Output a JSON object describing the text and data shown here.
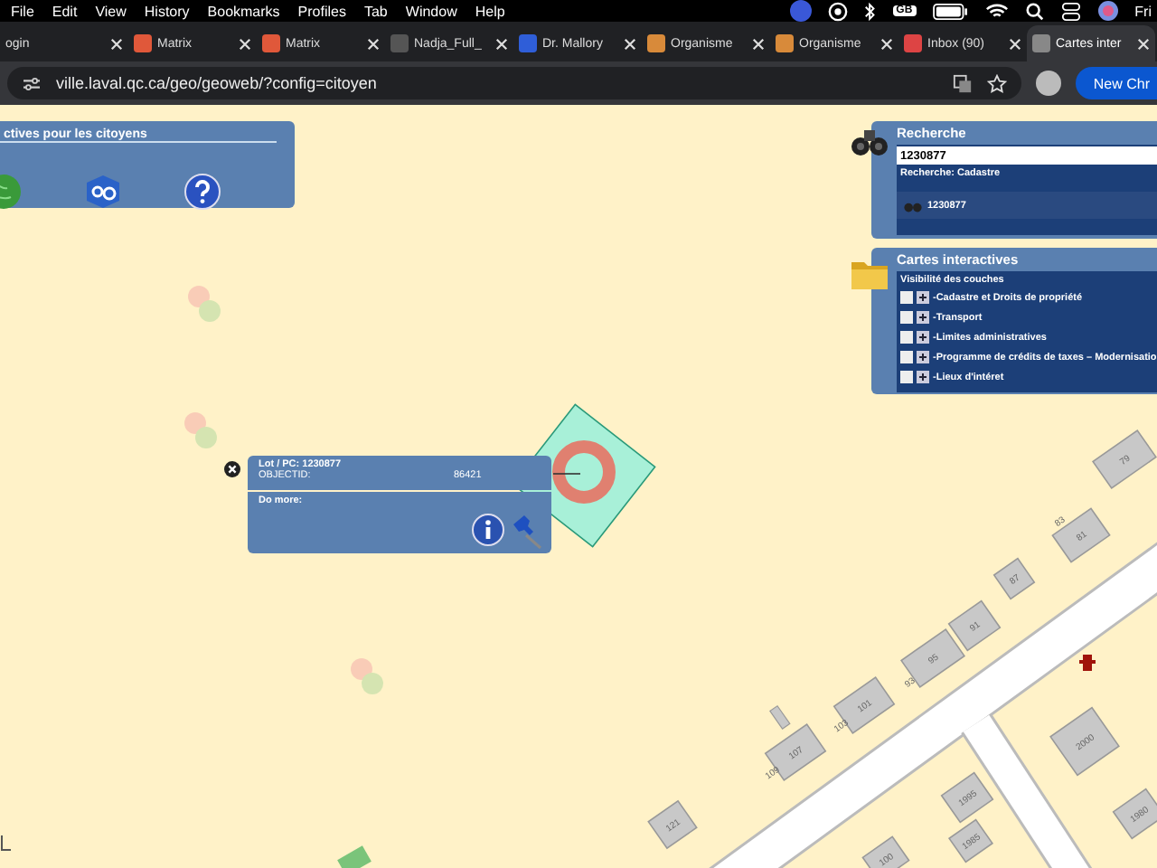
{
  "menu_bar": {
    "items": [
      "File",
      "Edit",
      "View",
      "History",
      "Bookmarks",
      "Profiles",
      "Tab",
      "Window",
      "Help"
    ],
    "badge": "GB",
    "clock": "Fri"
  },
  "tabs": [
    {
      "label": "ogin",
      "selected": false
    },
    {
      "label": "Matrix",
      "selected": false
    },
    {
      "label": "Matrix",
      "selected": false
    },
    {
      "label": "Nadja_Full_",
      "selected": false
    },
    {
      "label": "Dr. Mallory",
      "selected": false
    },
    {
      "label": "Organisme",
      "selected": false
    },
    {
      "label": "Organisme",
      "selected": false
    },
    {
      "label": "Inbox (90)",
      "selected": false
    },
    {
      "label": "Cartes inter",
      "selected": true
    }
  ],
  "address_bar": {
    "url": "ville.laval.qc.ca/geo/geoweb/?config=citoyen",
    "new_chrome_button": "New Chr"
  },
  "tools_panel": {
    "title": "ctives pour les citoyens"
  },
  "search_panel": {
    "title": "Recherche",
    "query": "1230877",
    "subtitle": "Recherche: Cadastre",
    "result": "1230877"
  },
  "layers_panel": {
    "title": "Cartes interactives",
    "heading": "Visibilité des couches",
    "layers": [
      {
        "label": "-Cadastre et Droits de propriété",
        "checked": false
      },
      {
        "label": "-Transport",
        "checked": false
      },
      {
        "label": "-Limites administratives",
        "checked": false
      },
      {
        "label": "-Programme de crédits de taxes – Modernisatio",
        "checked": false
      },
      {
        "label": "-Lieux d'intéret",
        "checked": false
      }
    ]
  },
  "popup": {
    "title": "Lot / PC: 1230877",
    "field_label": "OBJECTID:",
    "field_value": "86421",
    "section": "Do more:"
  },
  "map": {
    "building_labels": [
      "79",
      "81",
      "83",
      "87",
      "91",
      "95",
      "93",
      "101",
      "103",
      "107",
      "109",
      "2000",
      "1980",
      "1985",
      "1995",
      "121",
      "100"
    ]
  }
}
